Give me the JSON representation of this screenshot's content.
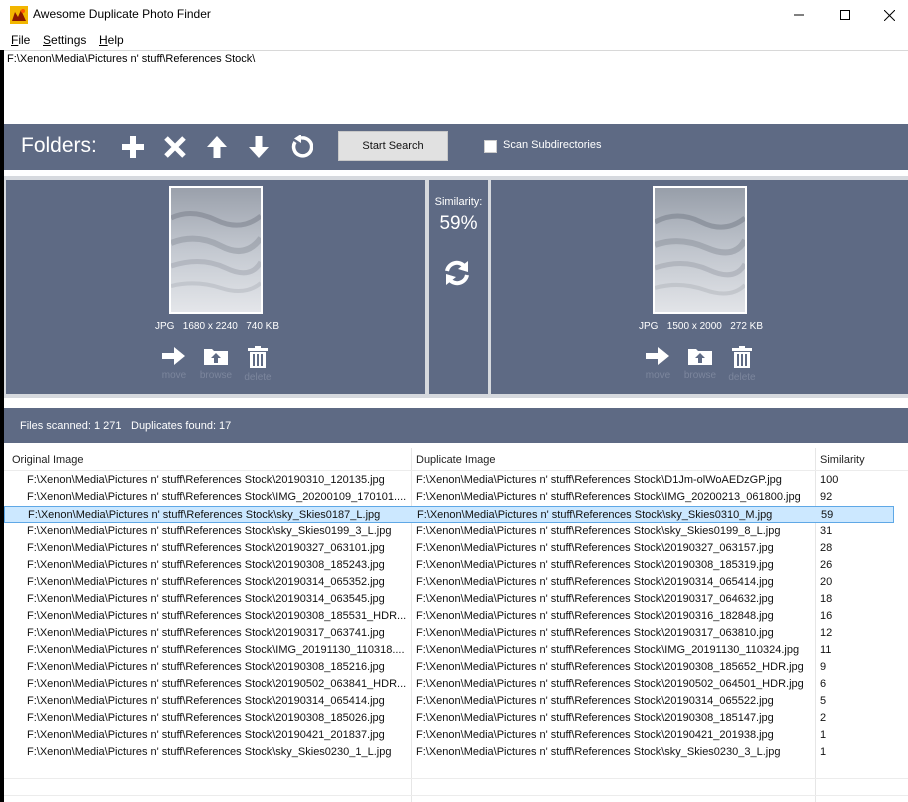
{
  "window": {
    "title": "Awesome Duplicate Photo Finder"
  },
  "menu": [
    {
      "label": "File",
      "key": "F",
      "rest": "ile"
    },
    {
      "label": "Settings",
      "key": "S",
      "rest": "ettings"
    },
    {
      "label": "Help",
      "key": "H",
      "rest": "elp"
    }
  ],
  "folders": {
    "path": "F:\\Xenon\\Media\\Pictures n' stuff\\References Stock\\"
  },
  "toolbar": {
    "folders_label": "Folders:",
    "start_search": "Start Search",
    "scan_subdirectories": "Scan Subdirectories",
    "scan_subdirectories_checked": false
  },
  "left_image": {
    "format": "JPG",
    "dimensions": "1680 x 2240",
    "size": "740 KB"
  },
  "right_image": {
    "format": "JPG",
    "dimensions": "1500 x 2000",
    "size": "272 KB"
  },
  "actions": {
    "move": "move",
    "browse": "browse",
    "delete": "delete"
  },
  "similarity": {
    "label": "Similarity:",
    "value": "59%"
  },
  "status": {
    "files_scanned": "Files scanned: 1 271",
    "duplicates_found": "Duplicates found: 17"
  },
  "table": {
    "headers": [
      "Original Image",
      "Duplicate Image",
      "Similarity"
    ],
    "rows": [
      [
        "F:\\Xenon\\Media\\Pictures n' stuff\\References Stock\\20190310_120135.jpg",
        "F:\\Xenon\\Media\\Pictures n' stuff\\References Stock\\D1Jm-olWoAEDzGP.jpg",
        "100"
      ],
      [
        "F:\\Xenon\\Media\\Pictures n' stuff\\References Stock\\IMG_20200109_170101....",
        "F:\\Xenon\\Media\\Pictures n' stuff\\References Stock\\IMG_20200213_061800.jpg",
        "92"
      ],
      [
        "F:\\Xenon\\Media\\Pictures n' stuff\\References Stock\\sky_Skies0187_L.jpg",
        "F:\\Xenon\\Media\\Pictures n' stuff\\References Stock\\sky_Skies0310_M.jpg",
        "59"
      ],
      [
        "F:\\Xenon\\Media\\Pictures n' stuff\\References Stock\\sky_Skies0199_3_L.jpg",
        "F:\\Xenon\\Media\\Pictures n' stuff\\References Stock\\sky_Skies0199_8_L.jpg",
        "31"
      ],
      [
        "F:\\Xenon\\Media\\Pictures n' stuff\\References Stock\\20190327_063101.jpg",
        "F:\\Xenon\\Media\\Pictures n' stuff\\References Stock\\20190327_063157.jpg",
        "28"
      ],
      [
        "F:\\Xenon\\Media\\Pictures n' stuff\\References Stock\\20190308_185243.jpg",
        "F:\\Xenon\\Media\\Pictures n' stuff\\References Stock\\20190308_185319.jpg",
        "26"
      ],
      [
        "F:\\Xenon\\Media\\Pictures n' stuff\\References Stock\\20190314_065352.jpg",
        "F:\\Xenon\\Media\\Pictures n' stuff\\References Stock\\20190314_065414.jpg",
        "20"
      ],
      [
        "F:\\Xenon\\Media\\Pictures n' stuff\\References Stock\\20190314_063545.jpg",
        "F:\\Xenon\\Media\\Pictures n' stuff\\References Stock\\20190317_064632.jpg",
        "18"
      ],
      [
        "F:\\Xenon\\Media\\Pictures n' stuff\\References Stock\\20190308_185531_HDR....",
        "F:\\Xenon\\Media\\Pictures n' stuff\\References Stock\\20190316_182848.jpg",
        "16"
      ],
      [
        "F:\\Xenon\\Media\\Pictures n' stuff\\References Stock\\20190317_063741.jpg",
        "F:\\Xenon\\Media\\Pictures n' stuff\\References Stock\\20190317_063810.jpg",
        "12"
      ],
      [
        "F:\\Xenon\\Media\\Pictures n' stuff\\References Stock\\IMG_20191130_110318....",
        "F:\\Xenon\\Media\\Pictures n' stuff\\References Stock\\IMG_20191130_110324.jpg",
        "11"
      ],
      [
        "F:\\Xenon\\Media\\Pictures n' stuff\\References Stock\\20190308_185216.jpg",
        "F:\\Xenon\\Media\\Pictures n' stuff\\References Stock\\20190308_185652_HDR.jpg",
        "9"
      ],
      [
        "F:\\Xenon\\Media\\Pictures n' stuff\\References Stock\\20190502_063841_HDR....",
        "F:\\Xenon\\Media\\Pictures n' stuff\\References Stock\\20190502_064501_HDR.jpg",
        "6"
      ],
      [
        "F:\\Xenon\\Media\\Pictures n' stuff\\References Stock\\20190314_065414.jpg",
        "F:\\Xenon\\Media\\Pictures n' stuff\\References Stock\\20190314_065522.jpg",
        "5"
      ],
      [
        "F:\\Xenon\\Media\\Pictures n' stuff\\References Stock\\20190308_185026.jpg",
        "F:\\Xenon\\Media\\Pictures n' stuff\\References Stock\\20190308_185147.jpg",
        "2"
      ],
      [
        "F:\\Xenon\\Media\\Pictures n' stuff\\References Stock\\20190421_201837.jpg",
        "F:\\Xenon\\Media\\Pictures n' stuff\\References Stock\\20190421_201938.jpg",
        "1"
      ],
      [
        "F:\\Xenon\\Media\\Pictures n' stuff\\References Stock\\sky_Skies0230_1_L.jpg",
        "F:\\Xenon\\Media\\Pictures n' stuff\\References Stock\\sky_Skies0230_3_L.jpg",
        "1"
      ]
    ],
    "selected_index": 2
  },
  "colors": {
    "panel": "#5e6a84",
    "selection": "#cce8ff",
    "disabled_label": "#7c869d"
  },
  "icons": [
    "app-icon",
    "minimize-icon",
    "maximize-icon",
    "close-icon",
    "add-folder-icon",
    "remove-folder-icon",
    "move-up-icon",
    "move-down-icon",
    "reset-icon",
    "swap-icon",
    "move-arrow-icon",
    "browse-folder-icon",
    "trash-icon"
  ]
}
